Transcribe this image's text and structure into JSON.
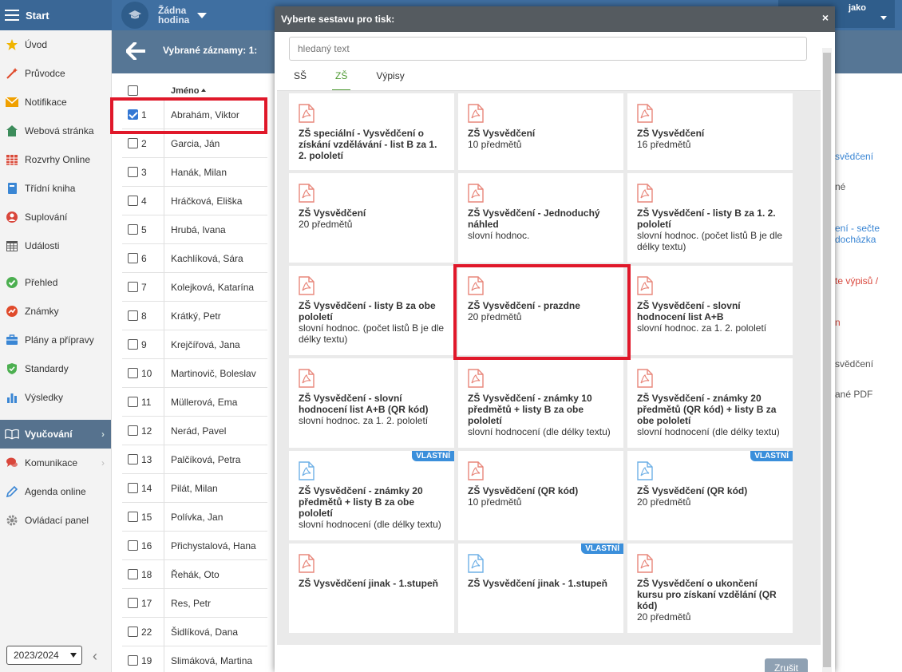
{
  "topbar": {
    "start_label": "Start",
    "hour_line1": "Žádna",
    "hour_line2": "hodina",
    "right_label": "jako"
  },
  "sidebar": {
    "items": [
      {
        "label": "Úvod",
        "icon": "star-icon",
        "color": "#f0b400"
      },
      {
        "label": "Průvodce",
        "icon": "wand-icon",
        "color": "#e04a2b"
      },
      {
        "label": "Notifikace",
        "icon": "envelope-icon",
        "color": "#f0a000"
      },
      {
        "label": "Webová stránka",
        "icon": "house-icon",
        "color": "#3c8c5b"
      },
      {
        "label": "Rozvrhy Online",
        "icon": "calendar-grid-icon",
        "color": "#d84a3a"
      },
      {
        "label": "Třídní kniha",
        "icon": "book-icon",
        "color": "#3a86d4"
      },
      {
        "label": "Suplování",
        "icon": "person-icon",
        "color": "#d9463b"
      },
      {
        "label": "Události",
        "icon": "calendar-icon",
        "color": "#555555"
      },
      {
        "label": "Přehled",
        "icon": "check-circle-icon",
        "color": "#4caf50"
      },
      {
        "label": "Známky",
        "icon": "chart-badge-icon",
        "color": "#e04a2b"
      },
      {
        "label": "Plány a přípravy",
        "icon": "briefcase-icon",
        "color": "#3a86d4"
      },
      {
        "label": "Standardy",
        "icon": "shield-check-icon",
        "color": "#4caf50"
      },
      {
        "label": "Výsledky",
        "icon": "bar-chart-icon",
        "color": "#3a86d4"
      },
      {
        "label": "Vyučování",
        "icon": "open-book-icon",
        "color": "#ffffff"
      },
      {
        "label": "Komunikace",
        "icon": "chat-icon",
        "color": "#d9463b"
      },
      {
        "label": "Agenda online",
        "icon": "pencil-icon",
        "color": "#3a86d4"
      },
      {
        "label": "Ovládací panel",
        "icon": "gear-icon",
        "color": "#888888"
      }
    ],
    "school_year": "2023/2024"
  },
  "records": {
    "title": "Vybrané záznamy: 1:",
    "name_header": "Jméno",
    "rows": [
      {
        "num": "1",
        "name": "Abrahám, Viktor",
        "checked": true
      },
      {
        "num": "2",
        "name": "Garcia, Ján",
        "checked": false
      },
      {
        "num": "3",
        "name": "Hanák, Milan",
        "checked": false
      },
      {
        "num": "4",
        "name": "Hráčková, Eliška",
        "checked": false
      },
      {
        "num": "5",
        "name": "Hrubá, Ivana",
        "checked": false
      },
      {
        "num": "6",
        "name": "Kachlíková, Sára",
        "checked": false
      },
      {
        "num": "7",
        "name": "Kolejková, Katarína",
        "checked": false
      },
      {
        "num": "8",
        "name": "Krátký, Petr",
        "checked": false
      },
      {
        "num": "9",
        "name": "Krejčířová, Jana",
        "checked": false
      },
      {
        "num": "10",
        "name": "Martinovič, Boleslav",
        "checked": false
      },
      {
        "num": "11",
        "name": "Müllerová, Ema",
        "checked": false
      },
      {
        "num": "12",
        "name": "Nerád, Pavel",
        "checked": false
      },
      {
        "num": "13",
        "name": "Palčíková, Petra",
        "checked": false
      },
      {
        "num": "14",
        "name": "Pilát, Milan",
        "checked": false
      },
      {
        "num": "15",
        "name": "Polívka, Jan",
        "checked": false
      },
      {
        "num": "16",
        "name": "Přichystalová, Hana",
        "checked": false
      },
      {
        "num": "18",
        "name": "Řehák, Oto",
        "checked": false
      },
      {
        "num": "17",
        "name": "Res, Petr",
        "checked": false
      },
      {
        "num": "22",
        "name": "Šidlíková, Dana",
        "checked": false
      },
      {
        "num": "19",
        "name": "Slimáková, Martina",
        "checked": false
      }
    ]
  },
  "behind": {
    "l1": "svědčení",
    "l2": "né",
    "l3": "ení - sečte",
    "l4": "docházka",
    "l5": "te výpisů /",
    "l6": "n",
    "l7": "svědčení",
    "l8": "ané PDF"
  },
  "modal": {
    "title": "Vyberte sestavu pro tisk:",
    "close": "×",
    "search_placeholder": "hledaný text",
    "tabs": [
      "SŠ",
      "ZŠ",
      "Výpisy"
    ],
    "active_tab": 1,
    "cancel_label": "Zrušit",
    "badge_label": "VLASTNÍ",
    "tiles": [
      {
        "title": "ZŠ speciální - Vysvědčení o získání vzdělávání - list B za 1. 2. pololetí",
        "sub": "",
        "custom": false
      },
      {
        "title": "ZŠ Vysvědčení",
        "sub": "10 předmětů",
        "custom": false
      },
      {
        "title": "ZŠ Vysvědčení",
        "sub": "16 předmětů",
        "custom": false
      },
      {
        "title": "ZŠ Vysvědčení",
        "sub": "20 předmětů",
        "custom": false
      },
      {
        "title": "ZŠ Vysvědčení - Jednoduchý náhled",
        "sub": "slovní hodnoc.",
        "custom": false
      },
      {
        "title": "ZŠ Vysvědčení - listy B za 1. 2. pololetí",
        "sub": "slovní hodnoc. (počet listů B je dle délky textu)",
        "custom": false
      },
      {
        "title": "ZŠ Vysvědčení - listy B za obe pololetí",
        "sub": "slovní hodnoc. (počet listů B je dle délky textu)",
        "custom": false
      },
      {
        "title": "ZŠ Vysvědčení - prazdne",
        "sub": "20 předmětů",
        "custom": false
      },
      {
        "title": "ZŠ Vysvědčení - slovní hodnocení list A+B",
        "sub": "slovní hodnoc. za 1. 2. pololetí",
        "custom": false
      },
      {
        "title": "ZŠ Vysvědčení - slovní hodnocení list A+B (QR kód)",
        "sub": "slovní hodnoc. za 1. 2. pololetí",
        "custom": false
      },
      {
        "title": "ZŠ Vysvědčení - známky 10 předmětů + listy B za obe pololetí",
        "sub": "slovní hodnocení (dle délky textu)",
        "custom": false
      },
      {
        "title": "ZŠ Vysvědčení - známky 20 předmětů (QR kód) + listy B za obe pololetí",
        "sub": "slovní hodnocení (dle délky textu)",
        "custom": false
      },
      {
        "title": "ZŠ Vysvědčení - známky 20 předmětů + listy B za obe pololetí",
        "sub": "slovní hodnocení (dle délky textu)",
        "custom": true
      },
      {
        "title": "ZŠ Vysvědčení (QR kód)",
        "sub": "10 předmětů",
        "custom": false
      },
      {
        "title": "ZŠ Vysvědčení (QR kód)",
        "sub": "20 předmětů",
        "custom": true
      },
      {
        "title": "ZŠ Vysvědčení jinak - 1.stupeň",
        "sub": "",
        "custom": false
      },
      {
        "title": "ZŠ Vysvědčení jinak - 1.stupeň",
        "sub": "",
        "custom": true
      },
      {
        "title": "ZŠ Vysvědčení o ukončení kursu pro získaní vzdělání (QR kód)",
        "sub": "20 předmětů",
        "custom": false
      }
    ]
  },
  "colors": {
    "topbar": "#3f6fa1",
    "accent_green": "#4e9a32",
    "pdf_red": "#e8877b",
    "pdf_blue": "#6fb0e6",
    "highlight_red": "#e0182a",
    "badge_blue": "#3b8fdb"
  }
}
